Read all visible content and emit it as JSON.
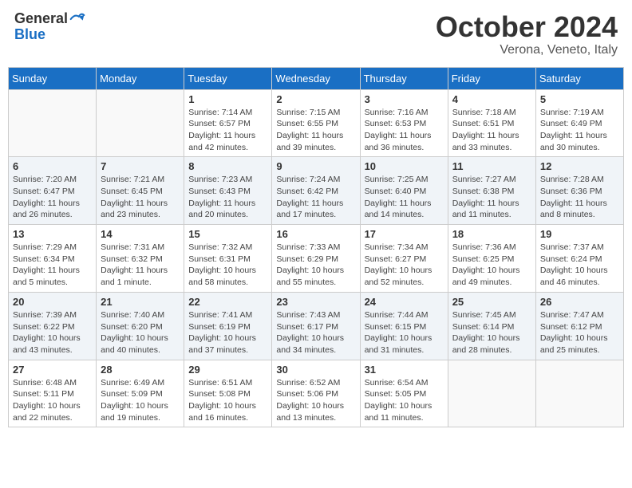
{
  "header": {
    "logo_general": "General",
    "logo_blue": "Blue",
    "month": "October 2024",
    "location": "Verona, Veneto, Italy"
  },
  "weekdays": [
    "Sunday",
    "Monday",
    "Tuesday",
    "Wednesday",
    "Thursday",
    "Friday",
    "Saturday"
  ],
  "weeks": [
    [
      {
        "day": "",
        "info": ""
      },
      {
        "day": "",
        "info": ""
      },
      {
        "day": "1",
        "info": "Sunrise: 7:14 AM\nSunset: 6:57 PM\nDaylight: 11 hours and 42 minutes."
      },
      {
        "day": "2",
        "info": "Sunrise: 7:15 AM\nSunset: 6:55 PM\nDaylight: 11 hours and 39 minutes."
      },
      {
        "day": "3",
        "info": "Sunrise: 7:16 AM\nSunset: 6:53 PM\nDaylight: 11 hours and 36 minutes."
      },
      {
        "day": "4",
        "info": "Sunrise: 7:18 AM\nSunset: 6:51 PM\nDaylight: 11 hours and 33 minutes."
      },
      {
        "day": "5",
        "info": "Sunrise: 7:19 AM\nSunset: 6:49 PM\nDaylight: 11 hours and 30 minutes."
      }
    ],
    [
      {
        "day": "6",
        "info": "Sunrise: 7:20 AM\nSunset: 6:47 PM\nDaylight: 11 hours and 26 minutes."
      },
      {
        "day": "7",
        "info": "Sunrise: 7:21 AM\nSunset: 6:45 PM\nDaylight: 11 hours and 23 minutes."
      },
      {
        "day": "8",
        "info": "Sunrise: 7:23 AM\nSunset: 6:43 PM\nDaylight: 11 hours and 20 minutes."
      },
      {
        "day": "9",
        "info": "Sunrise: 7:24 AM\nSunset: 6:42 PM\nDaylight: 11 hours and 17 minutes."
      },
      {
        "day": "10",
        "info": "Sunrise: 7:25 AM\nSunset: 6:40 PM\nDaylight: 11 hours and 14 minutes."
      },
      {
        "day": "11",
        "info": "Sunrise: 7:27 AM\nSunset: 6:38 PM\nDaylight: 11 hours and 11 minutes."
      },
      {
        "day": "12",
        "info": "Sunrise: 7:28 AM\nSunset: 6:36 PM\nDaylight: 11 hours and 8 minutes."
      }
    ],
    [
      {
        "day": "13",
        "info": "Sunrise: 7:29 AM\nSunset: 6:34 PM\nDaylight: 11 hours and 5 minutes."
      },
      {
        "day": "14",
        "info": "Sunrise: 7:31 AM\nSunset: 6:32 PM\nDaylight: 11 hours and 1 minute."
      },
      {
        "day": "15",
        "info": "Sunrise: 7:32 AM\nSunset: 6:31 PM\nDaylight: 10 hours and 58 minutes."
      },
      {
        "day": "16",
        "info": "Sunrise: 7:33 AM\nSunset: 6:29 PM\nDaylight: 10 hours and 55 minutes."
      },
      {
        "day": "17",
        "info": "Sunrise: 7:34 AM\nSunset: 6:27 PM\nDaylight: 10 hours and 52 minutes."
      },
      {
        "day": "18",
        "info": "Sunrise: 7:36 AM\nSunset: 6:25 PM\nDaylight: 10 hours and 49 minutes."
      },
      {
        "day": "19",
        "info": "Sunrise: 7:37 AM\nSunset: 6:24 PM\nDaylight: 10 hours and 46 minutes."
      }
    ],
    [
      {
        "day": "20",
        "info": "Sunrise: 7:39 AM\nSunset: 6:22 PM\nDaylight: 10 hours and 43 minutes."
      },
      {
        "day": "21",
        "info": "Sunrise: 7:40 AM\nSunset: 6:20 PM\nDaylight: 10 hours and 40 minutes."
      },
      {
        "day": "22",
        "info": "Sunrise: 7:41 AM\nSunset: 6:19 PM\nDaylight: 10 hours and 37 minutes."
      },
      {
        "day": "23",
        "info": "Sunrise: 7:43 AM\nSunset: 6:17 PM\nDaylight: 10 hours and 34 minutes."
      },
      {
        "day": "24",
        "info": "Sunrise: 7:44 AM\nSunset: 6:15 PM\nDaylight: 10 hours and 31 minutes."
      },
      {
        "day": "25",
        "info": "Sunrise: 7:45 AM\nSunset: 6:14 PM\nDaylight: 10 hours and 28 minutes."
      },
      {
        "day": "26",
        "info": "Sunrise: 7:47 AM\nSunset: 6:12 PM\nDaylight: 10 hours and 25 minutes."
      }
    ],
    [
      {
        "day": "27",
        "info": "Sunrise: 6:48 AM\nSunset: 5:11 PM\nDaylight: 10 hours and 22 minutes."
      },
      {
        "day": "28",
        "info": "Sunrise: 6:49 AM\nSunset: 5:09 PM\nDaylight: 10 hours and 19 minutes."
      },
      {
        "day": "29",
        "info": "Sunrise: 6:51 AM\nSunset: 5:08 PM\nDaylight: 10 hours and 16 minutes."
      },
      {
        "day": "30",
        "info": "Sunrise: 6:52 AM\nSunset: 5:06 PM\nDaylight: 10 hours and 13 minutes."
      },
      {
        "day": "31",
        "info": "Sunrise: 6:54 AM\nSunset: 5:05 PM\nDaylight: 10 hours and 11 minutes."
      },
      {
        "day": "",
        "info": ""
      },
      {
        "day": "",
        "info": ""
      }
    ]
  ]
}
